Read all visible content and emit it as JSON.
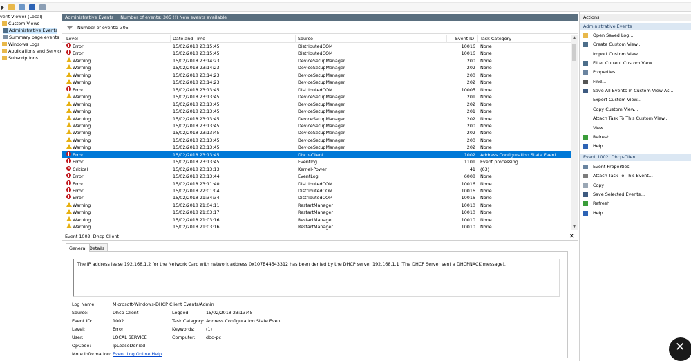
{
  "toolbar": {
    "icons": [
      "back-icon",
      "forward-icon",
      "folder-icon",
      "view-icon",
      "help-icon",
      "panel-icon"
    ]
  },
  "tree": {
    "items": [
      {
        "label": "vent Viewer (Local)",
        "indent": 0,
        "selected": false
      },
      {
        "label": "Custom Views",
        "indent": 1,
        "selected": false
      },
      {
        "label": "Administrative Events",
        "indent": 2,
        "selected": true
      },
      {
        "label": "Summary page events",
        "indent": 2,
        "selected": false
      },
      {
        "label": "Windows Logs",
        "indent": 1,
        "selected": false
      },
      {
        "label": "Applications and Services Lo",
        "indent": 1,
        "selected": false
      },
      {
        "label": "Subscriptions",
        "indent": 1,
        "selected": false
      }
    ]
  },
  "header": {
    "title": "Administrative Events",
    "info": "Number of events: 305 (!) New events available"
  },
  "filter": {
    "text": "Number of events: 305"
  },
  "columns": {
    "level": "Level",
    "date": "Date and Time",
    "source": "Source",
    "event_id": "Event ID",
    "task": "Task Category"
  },
  "rows": [
    {
      "level": "Error",
      "type": "err",
      "date": "15/02/2018 23:15:45",
      "source": "DistributedCOM",
      "id": "10016",
      "task": "None"
    },
    {
      "level": "Error",
      "type": "err",
      "date": "15/02/2018 23:15:45",
      "source": "DistributedCOM",
      "id": "10016",
      "task": "None"
    },
    {
      "level": "Warning",
      "type": "warn",
      "date": "15/02/2018 23:14:23",
      "source": "DeviceSetupManager",
      "id": "200",
      "task": "None"
    },
    {
      "level": "Warning",
      "type": "warn",
      "date": "15/02/2018 23:14:23",
      "source": "DeviceSetupManager",
      "id": "202",
      "task": "None"
    },
    {
      "level": "Warning",
      "type": "warn",
      "date": "15/02/2018 23:14:23",
      "source": "DeviceSetupManager",
      "id": "200",
      "task": "None"
    },
    {
      "level": "Warning",
      "type": "warn",
      "date": "15/02/2018 23:14:23",
      "source": "DeviceSetupManager",
      "id": "202",
      "task": "None"
    },
    {
      "level": "Error",
      "type": "err",
      "date": "15/02/2018 23:13:45",
      "source": "DistributedCOM",
      "id": "10005",
      "task": "None"
    },
    {
      "level": "Warning",
      "type": "warn",
      "date": "15/02/2018 23:13:45",
      "source": "DeviceSetupManager",
      "id": "201",
      "task": "None"
    },
    {
      "level": "Warning",
      "type": "warn",
      "date": "15/02/2018 23:13:45",
      "source": "DeviceSetupManager",
      "id": "202",
      "task": "None"
    },
    {
      "level": "Warning",
      "type": "warn",
      "date": "15/02/2018 23:13:45",
      "source": "DeviceSetupManager",
      "id": "201",
      "task": "None"
    },
    {
      "level": "Warning",
      "type": "warn",
      "date": "15/02/2018 23:13:45",
      "source": "DeviceSetupManager",
      "id": "202",
      "task": "None"
    },
    {
      "level": "Warning",
      "type": "warn",
      "date": "15/02/2018 23:13:45",
      "source": "DeviceSetupManager",
      "id": "200",
      "task": "None"
    },
    {
      "level": "Warning",
      "type": "warn",
      "date": "15/02/2018 23:13:45",
      "source": "DeviceSetupManager",
      "id": "202",
      "task": "None"
    },
    {
      "level": "Warning",
      "type": "warn",
      "date": "15/02/2018 23:13:45",
      "source": "DeviceSetupManager",
      "id": "200",
      "task": "None"
    },
    {
      "level": "Warning",
      "type": "warn",
      "date": "15/02/2018 23:13:45",
      "source": "DeviceSetupManager",
      "id": "202",
      "task": "None"
    },
    {
      "level": "Error",
      "type": "err",
      "date": "15/02/2018 23:13:45",
      "source": "Dhcp-Client",
      "id": "1002",
      "task": "Address Configuration State Event",
      "selected": true
    },
    {
      "level": "Error",
      "type": "err",
      "date": "15/02/2018 23:13:45",
      "source": "Eventlog",
      "id": "1101",
      "task": "Event processing"
    },
    {
      "level": "Critical",
      "type": "crit",
      "date": "15/02/2018 23:13:13",
      "source": "Kernel-Power",
      "id": "41",
      "task": "(63)"
    },
    {
      "level": "Error",
      "type": "err",
      "date": "15/02/2018 23:13:44",
      "source": "EventLog",
      "id": "6008",
      "task": "None"
    },
    {
      "level": "Error",
      "type": "err",
      "date": "15/02/2018 23:11:40",
      "source": "DistributedCOM",
      "id": "10016",
      "task": "None"
    },
    {
      "level": "Error",
      "type": "err",
      "date": "15/02/2018 22:01:04",
      "source": "DistributedCOM",
      "id": "10016",
      "task": "None"
    },
    {
      "level": "Error",
      "type": "err",
      "date": "15/02/2018 21:34:34",
      "source": "DistributedCOM",
      "id": "10016",
      "task": "None"
    },
    {
      "level": "Warning",
      "type": "warn",
      "date": "15/02/2018 21:04:11",
      "source": "RestartManager",
      "id": "10010",
      "task": "None"
    },
    {
      "level": "Warning",
      "type": "warn",
      "date": "15/02/2018 21:03:17",
      "source": "RestartManager",
      "id": "10010",
      "task": "None"
    },
    {
      "level": "Warning",
      "type": "warn",
      "date": "15/02/2018 21:03:16",
      "source": "RestartManager",
      "id": "10010",
      "task": "None"
    },
    {
      "level": "Warning",
      "type": "warn",
      "date": "15/02/2018 21:03:16",
      "source": "RestartManager",
      "id": "10010",
      "task": "None"
    }
  ],
  "detail": {
    "title": "Event 1002, Dhcp-Client",
    "tab_general": "General",
    "tab_details": "Details",
    "description": "The IP address lease 192.168.1.2 for the Network Card with network address 0x107B44543312 has been denied by the DHCP server 192.168.1.1 (The DHCP Server sent a DHCPNACK message).",
    "log_name_label": "Log Name:",
    "log_name": "Microsoft-Windows-DHCP Client Events/Admin",
    "source_label": "Source:",
    "source": "Dhcp-Client",
    "logged_label": "Logged:",
    "logged": "15/02/2018 23:13:45",
    "event_id_label": "Event ID:",
    "event_id": "1002",
    "task_label": "Task Category:",
    "task": "Address Configuration State Event",
    "level_label": "Level:",
    "level": "Error",
    "keywords_label": "Keywords:",
    "keywords": "(1)",
    "user_label": "User:",
    "user": "LOCAL SERVICE",
    "computer_label": "Computer:",
    "computer": "dbd-pc",
    "opcode_label": "OpCode:",
    "opcode": "IpLeaseDenied",
    "more_label": "More Information:",
    "more_link": "Event Log Online Help"
  },
  "actions": {
    "title": "Actions",
    "section1": "Administrative Events",
    "items1": [
      {
        "label": "Open Saved Log...",
        "icon": "folder-icon"
      },
      {
        "label": "Create Custom View...",
        "icon": "filter-icon"
      },
      {
        "label": "Import Custom View...",
        "icon": ""
      },
      {
        "label": "Filter Current Custom View...",
        "icon": "filter-icon"
      },
      {
        "label": "Properties",
        "icon": "properties-icon"
      },
      {
        "label": "Find...",
        "icon": "find-icon"
      },
      {
        "label": "Save All Events in Custom View As...",
        "icon": "save-icon"
      },
      {
        "label": "Export Custom View...",
        "icon": ""
      },
      {
        "label": "Copy Custom View...",
        "icon": ""
      },
      {
        "label": "Attach Task To This Custom View...",
        "icon": ""
      },
      {
        "label": "View",
        "icon": ""
      },
      {
        "label": "Refresh",
        "icon": "refresh-icon"
      },
      {
        "label": "Help",
        "icon": "help-icon"
      }
    ],
    "section2": "Event 1002, Dhcp-Client",
    "items2": [
      {
        "label": "Event Properties",
        "icon": "properties-icon"
      },
      {
        "label": "Attach Task To This Event...",
        "icon": "task-icon"
      },
      {
        "label": "Copy",
        "icon": "copy-icon"
      },
      {
        "label": "Save Selected Events...",
        "icon": "save-icon"
      },
      {
        "label": "Refresh",
        "icon": "refresh-icon"
      },
      {
        "label": "Help",
        "icon": "help-icon"
      }
    ]
  }
}
